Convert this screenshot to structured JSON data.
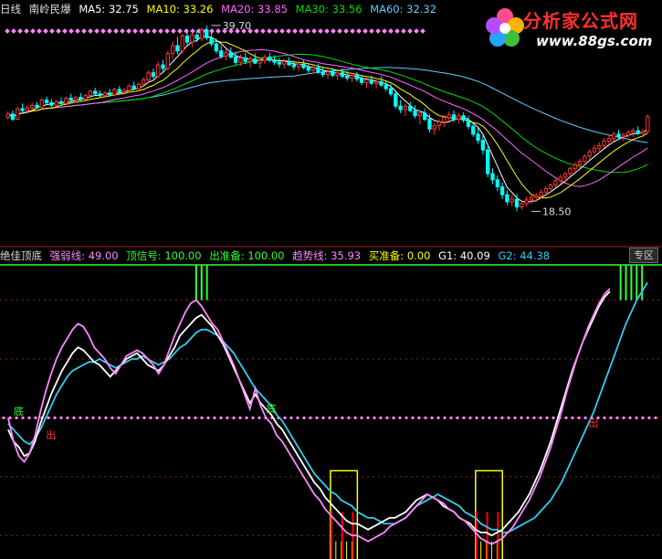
{
  "top_legend": {
    "period": "日线",
    "stock": "南岭民爆",
    "ma5_label": "MA5:",
    "ma5": "32.75",
    "ma10_label": "MA10:",
    "ma10": "33.26",
    "ma20_label": "MA20:",
    "ma20": "33.85",
    "ma30_label": "MA30:",
    "ma30": "33.56",
    "ma60_label": "MA60:",
    "ma60": "32.32"
  },
  "ind_legend": {
    "name": "绝佳顶底",
    "s1_label": "强弱线:",
    "s1": "49.00",
    "s2_label": "顶信号:",
    "s2": "100.00",
    "s3_label": "出准备:",
    "s3": "100.00",
    "s4_label": "趋势线:",
    "s4": "35.93",
    "s5_label": "买准备:",
    "s5": "0.00",
    "s6_label": "G1:",
    "s6": "40.09",
    "s7_label": "G2:",
    "s7": "44.38"
  },
  "zoom_label": "专区",
  "logo": {
    "line1": "分析家公式网",
    "line2": "www.88gs.com"
  },
  "colors": {
    "ma5": "#ffffff",
    "ma10": "#ffff00",
    "ma20": "#ff66ff",
    "ma30": "#00dd00",
    "ma60": "#66ccff",
    "up": "#ff3333",
    "down": "#00ffff",
    "white": "#ffffff",
    "pink": "#ff88ff",
    "cyan": "#33ccee",
    "green": "#33ff33",
    "yellow": "#ffff00",
    "red": "#ff0000"
  },
  "chart_data": [
    {
      "type": "candlestick",
      "ylim": [
        15,
        40
      ],
      "annotations": [
        {
          "text": "39.70",
          "x": 42,
          "y": 39.7
        },
        {
          "text": "18.50",
          "x": 108,
          "y": 18.5
        }
      ],
      "candles": [
        [
          29.2,
          29.9,
          29.0,
          29.6
        ],
        [
          29.6,
          30.0,
          28.8,
          29.0
        ],
        [
          29.0,
          30.4,
          28.9,
          30.2
        ],
        [
          30.2,
          30.8,
          29.7,
          30.0
        ],
        [
          30.0,
          30.6,
          29.6,
          30.3
        ],
        [
          30.3,
          30.9,
          30.0,
          30.6
        ],
        [
          30.6,
          31.0,
          30.2,
          30.4
        ],
        [
          30.4,
          31.4,
          30.2,
          31.2
        ],
        [
          31.2,
          31.6,
          30.7,
          30.9
        ],
        [
          30.9,
          31.3,
          30.3,
          30.6
        ],
        [
          30.6,
          31.2,
          30.4,
          31.0
        ],
        [
          31.0,
          31.5,
          30.6,
          30.8
        ],
        [
          30.8,
          31.6,
          30.6,
          31.4
        ],
        [
          31.4,
          31.9,
          31.0,
          31.2
        ],
        [
          31.2,
          31.7,
          30.9,
          31.5
        ],
        [
          31.5,
          32.0,
          31.1,
          31.3
        ],
        [
          31.3,
          31.9,
          31.0,
          31.7
        ],
        [
          31.7,
          32.4,
          31.4,
          32.2
        ],
        [
          32.2,
          32.6,
          31.7,
          31.9
        ],
        [
          31.9,
          32.3,
          31.5,
          31.7
        ],
        [
          31.7,
          32.2,
          31.4,
          32.0
        ],
        [
          32.0,
          32.5,
          31.6,
          31.8
        ],
        [
          31.8,
          32.6,
          31.6,
          32.4
        ],
        [
          32.4,
          32.8,
          31.9,
          32.1
        ],
        [
          32.1,
          32.6,
          31.8,
          32.3
        ],
        [
          32.3,
          33.0,
          32.0,
          32.8
        ],
        [
          32.8,
          33.3,
          32.3,
          32.5
        ],
        [
          32.5,
          33.2,
          32.2,
          33.0
        ],
        [
          33.0,
          33.8,
          32.7,
          33.5
        ],
        [
          33.5,
          34.6,
          33.2,
          34.3
        ],
        [
          34.3,
          34.8,
          33.6,
          33.9
        ],
        [
          33.9,
          35.6,
          33.7,
          35.2
        ],
        [
          35.2,
          35.8,
          34.4,
          34.8
        ],
        [
          34.8,
          36.8,
          34.6,
          36.5
        ],
        [
          36.5,
          37.9,
          35.9,
          37.4
        ],
        [
          37.4,
          38.4,
          36.4,
          36.8
        ],
        [
          36.8,
          38.8,
          36.5,
          38.5
        ],
        [
          38.5,
          39.0,
          37.4,
          37.8
        ],
        [
          37.8,
          39.0,
          37.2,
          38.6
        ],
        [
          38.6,
          39.2,
          37.8,
          38.2
        ],
        [
          38.2,
          39.5,
          37.9,
          39.2
        ],
        [
          39.2,
          39.7,
          38.0,
          38.3
        ],
        [
          38.3,
          38.9,
          37.3,
          37.6
        ],
        [
          37.6,
          38.2,
          36.5,
          36.8
        ],
        [
          36.8,
          37.4,
          35.9,
          36.2
        ],
        [
          36.2,
          37.0,
          35.7,
          36.6
        ],
        [
          36.6,
          37.2,
          35.9,
          36.1
        ],
        [
          36.1,
          36.7,
          35.2,
          35.5
        ],
        [
          35.5,
          36.4,
          35.1,
          36.0
        ],
        [
          36.0,
          36.6,
          35.3,
          35.6
        ],
        [
          35.6,
          36.2,
          34.9,
          35.9
        ],
        [
          35.9,
          36.5,
          35.3,
          35.4
        ],
        [
          35.4,
          36.0,
          34.8,
          35.7
        ],
        [
          35.7,
          36.4,
          35.3,
          36.1
        ],
        [
          36.1,
          36.6,
          35.5,
          35.8
        ],
        [
          35.8,
          36.3,
          35.2,
          35.5
        ],
        [
          35.5,
          36.0,
          34.9,
          35.3
        ],
        [
          35.3,
          35.9,
          34.8,
          35.6
        ],
        [
          35.6,
          36.1,
          35.1,
          35.2
        ],
        [
          35.2,
          35.7,
          34.6,
          35.0
        ],
        [
          35.0,
          35.6,
          34.5,
          35.3
        ],
        [
          35.3,
          35.8,
          34.7,
          34.9
        ],
        [
          34.9,
          35.4,
          34.3,
          34.6
        ],
        [
          34.6,
          35.2,
          34.2,
          34.9
        ],
        [
          34.9,
          35.3,
          34.2,
          34.4
        ],
        [
          34.4,
          34.9,
          33.8,
          34.1
        ],
        [
          34.1,
          34.7,
          33.6,
          34.4
        ],
        [
          34.4,
          34.9,
          33.8,
          34.0
        ],
        [
          34.0,
          34.6,
          33.5,
          34.3
        ],
        [
          34.3,
          34.8,
          33.7,
          33.9
        ],
        [
          33.9,
          34.5,
          33.4,
          33.7
        ],
        [
          33.7,
          34.3,
          33.2,
          34.0
        ],
        [
          34.0,
          34.4,
          33.3,
          33.6
        ],
        [
          33.6,
          34.1,
          32.9,
          33.2
        ],
        [
          33.2,
          33.8,
          32.6,
          33.5
        ],
        [
          33.5,
          34.0,
          32.9,
          33.1
        ],
        [
          33.1,
          33.7,
          32.5,
          33.3
        ],
        [
          33.3,
          33.9,
          32.7,
          32.9
        ],
        [
          32.9,
          33.4,
          32.2,
          32.5
        ],
        [
          32.5,
          33.0,
          31.6,
          31.9
        ],
        [
          31.9,
          32.2,
          30.2,
          30.5
        ],
        [
          30.5,
          31.2,
          29.7,
          30.1
        ],
        [
          30.1,
          30.8,
          29.4,
          30.5
        ],
        [
          30.5,
          31.0,
          29.8,
          30.0
        ],
        [
          30.0,
          30.6,
          29.1,
          29.4
        ],
        [
          29.4,
          30.0,
          28.4,
          29.7
        ],
        [
          29.7,
          30.2,
          28.8,
          29.0
        ],
        [
          29.0,
          29.6,
          27.5,
          27.9
        ],
        [
          27.9,
          28.6,
          27.2,
          28.3
        ],
        [
          28.3,
          29.0,
          27.7,
          28.7
        ],
        [
          28.7,
          29.5,
          28.1,
          29.2
        ],
        [
          29.2,
          29.9,
          28.8,
          29.5
        ],
        [
          29.5,
          30.0,
          28.7,
          29.0
        ],
        [
          29.0,
          29.7,
          28.5,
          29.4
        ],
        [
          29.4,
          29.8,
          28.6,
          28.9
        ],
        [
          28.9,
          29.4,
          27.9,
          28.2
        ],
        [
          28.2,
          28.7,
          27.0,
          27.3
        ],
        [
          27.3,
          28.0,
          26.2,
          26.6
        ],
        [
          26.6,
          27.2,
          25.0,
          25.5
        ],
        [
          25.5,
          25.9,
          22.4,
          22.8
        ],
        [
          22.8,
          23.4,
          21.6,
          22.1
        ],
        [
          22.1,
          22.6,
          20.8,
          21.3
        ],
        [
          21.3,
          21.8,
          19.9,
          20.4
        ],
        [
          20.4,
          20.9,
          19.2,
          19.6
        ],
        [
          19.6,
          20.4,
          19.1,
          19.9
        ],
        [
          19.9,
          20.5,
          18.5,
          19.0
        ],
        [
          19.0,
          19.8,
          18.7,
          19.4
        ],
        [
          19.4,
          20.2,
          19.0,
          19.8
        ],
        [
          19.8,
          20.3,
          19.3,
          20.1
        ],
        [
          20.1,
          20.6,
          19.6,
          20.3
        ],
        [
          20.3,
          21.0,
          20.0,
          20.7
        ],
        [
          20.7,
          21.4,
          20.4,
          21.1
        ],
        [
          21.1,
          21.7,
          20.7,
          21.5
        ],
        [
          21.5,
          22.3,
          21.2,
          22.0
        ],
        [
          22.0,
          22.7,
          21.6,
          22.4
        ],
        [
          22.4,
          23.0,
          21.8,
          22.8
        ],
        [
          22.8,
          23.6,
          22.5,
          23.4
        ],
        [
          23.4,
          24.1,
          23.0,
          23.8
        ],
        [
          23.8,
          24.5,
          23.4,
          24.2
        ],
        [
          24.2,
          25.0,
          24.0,
          24.8
        ],
        [
          24.8,
          25.6,
          24.4,
          25.3
        ],
        [
          25.3,
          26.1,
          25.0,
          25.7
        ],
        [
          25.7,
          26.4,
          25.2,
          26.0
        ],
        [
          26.0,
          26.9,
          25.7,
          26.5
        ],
        [
          26.5,
          27.2,
          26.1,
          26.8
        ],
        [
          26.8,
          27.6,
          26.5,
          27.3
        ],
        [
          27.3,
          27.8,
          26.7,
          27.0
        ],
        [
          27.0,
          27.5,
          26.5,
          27.2
        ],
        [
          27.2,
          27.8,
          26.9,
          27.5
        ],
        [
          27.5,
          28.0,
          27.0,
          27.7
        ],
        [
          27.7,
          28.2,
          27.2,
          27.4
        ],
        [
          27.4,
          27.9,
          26.9,
          27.6
        ],
        [
          27.6,
          29.6,
          27.4,
          29.3
        ]
      ]
    },
    {
      "type": "line",
      "ylim": [
        0,
        100
      ],
      "markers": [
        {
          "text": "底",
          "x": 1,
          "y": 49,
          "color": "#33ff33"
        },
        {
          "text": "出",
          "x": 7,
          "y": 41,
          "color": "#ff3333"
        },
        {
          "text": "底",
          "x": 48,
          "y": 50,
          "color": "#33ff33"
        },
        {
          "text": "出",
          "x": 108,
          "y": 45,
          "color": "#ff3333"
        }
      ],
      "dotted_level": 48,
      "top_signal_indices": [
        35,
        36,
        37,
        114,
        115,
        116,
        117,
        118
      ],
      "yellow_boxes": [
        [
          60,
          65
        ],
        [
          87,
          92
        ]
      ],
      "series": [
        {
          "name": "G2",
          "color": "#33ccee",
          "values": [
            46,
            44,
            42,
            40,
            39,
            41,
            44,
            48,
            52,
            56,
            59,
            62,
            64,
            65,
            66,
            67,
            67,
            68,
            67,
            66,
            65,
            66,
            67,
            68,
            68,
            69,
            68,
            67,
            66,
            67,
            68,
            70,
            72,
            73,
            75,
            77,
            78,
            78,
            77,
            76,
            74,
            72,
            70,
            67,
            64,
            61,
            58,
            56,
            54,
            52,
            49,
            47,
            44,
            41,
            38,
            35,
            32,
            29,
            27,
            25,
            23,
            22,
            20,
            19,
            18,
            16,
            15,
            14,
            14,
            13,
            12,
            12,
            12,
            13,
            14,
            16,
            18,
            19,
            20,
            21,
            22,
            21,
            20,
            19,
            18,
            16,
            15,
            14,
            12,
            11,
            10,
            10,
            9,
            9,
            10,
            11,
            12,
            13,
            14,
            16,
            18,
            20,
            23,
            26,
            30,
            34,
            38,
            42,
            46,
            50,
            55,
            60,
            65,
            70,
            75,
            80,
            84,
            88,
            91,
            94
          ]
        },
        {
          "name": "white",
          "color": "#ffffff",
          "values": [
            44,
            40,
            38,
            35,
            36,
            40,
            46,
            51,
            56,
            60,
            64,
            67,
            70,
            72,
            71,
            69,
            67,
            66,
            64,
            62,
            64,
            66,
            68,
            69,
            70,
            68,
            66,
            65,
            64,
            66,
            69,
            72,
            76,
            78,
            80,
            82,
            83,
            81,
            79,
            76,
            73,
            69,
            65,
            61,
            57,
            53,
            56,
            53,
            51,
            49,
            46,
            44,
            41,
            38,
            35,
            32,
            29,
            26,
            24,
            21,
            19,
            17,
            15,
            13,
            12,
            12,
            11,
            10,
            11,
            12,
            13,
            14,
            14,
            15,
            16,
            18,
            20,
            21,
            22,
            21,
            20,
            18,
            17,
            16,
            14,
            13,
            12,
            10,
            9,
            9,
            8,
            9,
            10,
            12,
            14,
            16,
            19,
            22,
            26,
            30,
            35,
            40,
            46,
            52,
            58,
            64,
            69,
            74,
            78,
            82,
            86,
            89,
            91
          ]
        },
        {
          "name": "pink",
          "color": "#ff88ff",
          "values": [
            48,
            40,
            35,
            33,
            36,
            42,
            50,
            57,
            63,
            68,
            72,
            75,
            78,
            80,
            79,
            76,
            72,
            70,
            68,
            65,
            63,
            66,
            69,
            70,
            71,
            70,
            68,
            66,
            63,
            66,
            71,
            76,
            80,
            84,
            87,
            88,
            86,
            83,
            80,
            78,
            74,
            70,
            66,
            61,
            56,
            51,
            58,
            52,
            48,
            46,
            42,
            40,
            37,
            34,
            31,
            28,
            25,
            22,
            20,
            17,
            15,
            13,
            11,
            9,
            8,
            8,
            7,
            6,
            7,
            8,
            9,
            11,
            12,
            13,
            14,
            16,
            18,
            20,
            22,
            21,
            20,
            19,
            17,
            16,
            14,
            13,
            11,
            9,
            7,
            6,
            5,
            6,
            7,
            9,
            11,
            14,
            17,
            20,
            24,
            28,
            33,
            38,
            44,
            50,
            57,
            63,
            69,
            74,
            79,
            83,
            87,
            90,
            92
          ]
        }
      ]
    }
  ]
}
